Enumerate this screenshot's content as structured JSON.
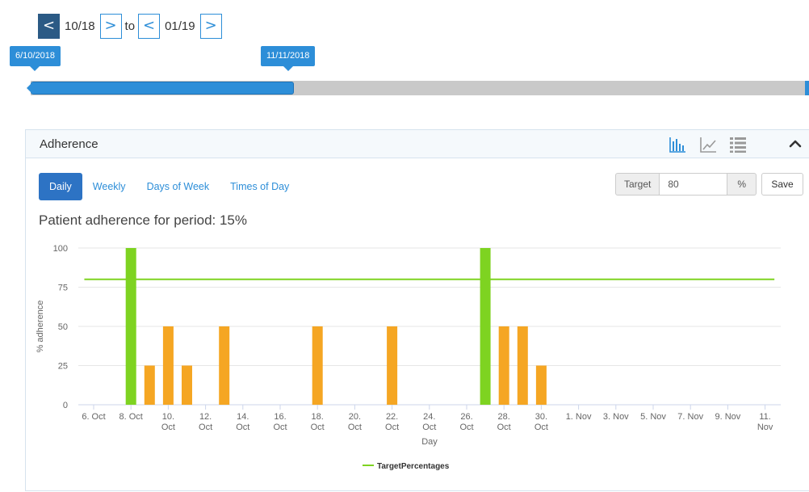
{
  "range_nav": {
    "prev_from_label": "<",
    "from_value": "10/18",
    "next_from_label": ">",
    "to_label": "to",
    "prev_to_label": "<",
    "to_value": "01/19",
    "next_to_label": ">"
  },
  "slider": {
    "start_date": "6/10/2018",
    "end_date": "11/11/2018",
    "fill_fraction": 0.34,
    "accent": "#2d8ed8"
  },
  "panel": {
    "title": "Adherence",
    "icons": [
      "bar-chart-icon",
      "line-chart-icon",
      "list-icon",
      "chevron-up-icon"
    ]
  },
  "tabs": [
    {
      "label": "Daily",
      "active": true
    },
    {
      "label": "Weekly",
      "active": false
    },
    {
      "label": "Days of Week",
      "active": false
    },
    {
      "label": "Times of Day",
      "active": false
    }
  ],
  "target": {
    "label": "Target",
    "value": "80",
    "unit": "%",
    "save_label": "Save"
  },
  "summary": "Patient adherence for period: 15%",
  "chart_data": {
    "type": "bar",
    "ylabel": "% adherence",
    "xlabel": "Day",
    "ylim": [
      0,
      100
    ],
    "yticks": [
      0,
      25,
      50,
      75,
      100
    ],
    "grid": true,
    "x_day_start": "6. Oct",
    "x_ticks": [
      {
        "day": 0,
        "l1": "6. Oct",
        "l2": ""
      },
      {
        "day": 2,
        "l1": "8. Oct",
        "l2": ""
      },
      {
        "day": 4,
        "l1": "10.",
        "l2": "Oct"
      },
      {
        "day": 6,
        "l1": "12.",
        "l2": "Oct"
      },
      {
        "day": 8,
        "l1": "14.",
        "l2": "Oct"
      },
      {
        "day": 10,
        "l1": "16.",
        "l2": "Oct"
      },
      {
        "day": 12,
        "l1": "18.",
        "l2": "Oct"
      },
      {
        "day": 14,
        "l1": "20.",
        "l2": "Oct"
      },
      {
        "day": 16,
        "l1": "22.",
        "l2": "Oct"
      },
      {
        "day": 18,
        "l1": "24.",
        "l2": "Oct"
      },
      {
        "day": 20,
        "l1": "26.",
        "l2": "Oct"
      },
      {
        "day": 22,
        "l1": "28.",
        "l2": "Oct"
      },
      {
        "day": 24,
        "l1": "30.",
        "l2": "Oct"
      },
      {
        "day": 26,
        "l1": "1. Nov",
        "l2": ""
      },
      {
        "day": 28,
        "l1": "3. Nov",
        "l2": ""
      },
      {
        "day": 30,
        "l1": "5. Nov",
        "l2": ""
      },
      {
        "day": 32,
        "l1": "7. Nov",
        "l2": ""
      },
      {
        "day": 34,
        "l1": "9. Nov",
        "l2": ""
      },
      {
        "day": 36,
        "l1": "11.",
        "l2": "Nov"
      }
    ],
    "bars": [
      {
        "date": "8. Oct",
        "day": 2,
        "value": 100,
        "color": "#7ed321"
      },
      {
        "date": "9. Oct",
        "day": 3,
        "value": 25,
        "color": "#f5a623"
      },
      {
        "date": "10. Oct",
        "day": 4,
        "value": 50,
        "color": "#f5a623"
      },
      {
        "date": "11. Oct",
        "day": 5,
        "value": 25,
        "color": "#f5a623"
      },
      {
        "date": "13. Oct",
        "day": 7,
        "value": 50,
        "color": "#f5a623"
      },
      {
        "date": "18. Oct",
        "day": 12,
        "value": 50,
        "color": "#f5a623"
      },
      {
        "date": "22. Oct",
        "day": 16,
        "value": 50,
        "color": "#f5a623"
      },
      {
        "date": "27. Oct",
        "day": 21,
        "value": 100,
        "color": "#7ed321"
      },
      {
        "date": "28. Oct",
        "day": 22,
        "value": 50,
        "color": "#f5a623"
      },
      {
        "date": "29. Oct",
        "day": 23,
        "value": 50,
        "color": "#f5a623"
      },
      {
        "date": "30. Oct",
        "day": 24,
        "value": 25,
        "color": "#f5a623"
      }
    ],
    "series": [
      {
        "name": "TargetPercentages",
        "value": 80,
        "day_range": [
          -0.5,
          36.5
        ],
        "color": "#7ed321"
      }
    ],
    "legend_placement": "bottom-center"
  }
}
